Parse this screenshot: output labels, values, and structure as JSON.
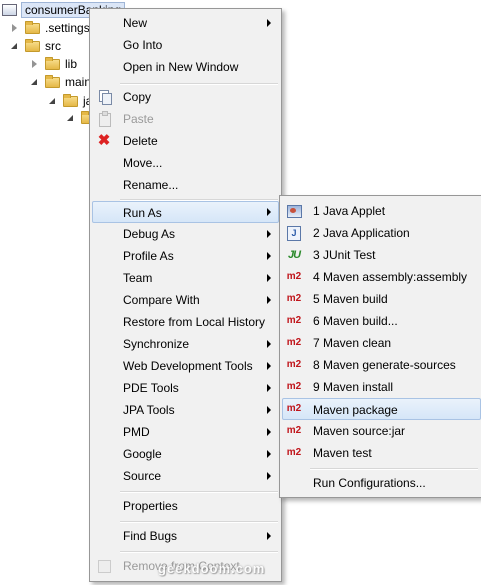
{
  "tree": {
    "project": "consumerBanking",
    "items": [
      {
        "label": ".settings"
      },
      {
        "label": "src"
      },
      {
        "label": "lib"
      },
      {
        "label": "main"
      },
      {
        "label": "ja"
      }
    ]
  },
  "context_menu": {
    "new": "New",
    "go_into": "Go Into",
    "open_in_new_window": "Open in New Window",
    "copy": "Copy",
    "paste": "Paste",
    "delete": "Delete",
    "move": "Move...",
    "rename": "Rename...",
    "run_as": "Run As",
    "debug_as": "Debug As",
    "profile_as": "Profile As",
    "team": "Team",
    "compare_with": "Compare With",
    "restore_from_local_history": "Restore from Local History",
    "synchronize": "Synchronize",
    "web_development_tools": "Web Development Tools",
    "pde_tools": "PDE Tools",
    "jpa_tools": "JPA Tools",
    "pmd": "PMD",
    "google": "Google",
    "source": "Source",
    "properties": "Properties",
    "find_bugs": "Find Bugs",
    "remove_from_context": "Remove from Context"
  },
  "run_as_menu": {
    "items": [
      {
        "label": "1 Java Applet",
        "icon": "java-applet-icon"
      },
      {
        "label": "2 Java Application",
        "icon": "java-application-icon"
      },
      {
        "label": "3 JUnit Test",
        "icon": "junit-icon"
      },
      {
        "label": "4 Maven assembly:assembly",
        "icon": "maven-m2-icon"
      },
      {
        "label": "5 Maven build",
        "icon": "maven-m2-icon"
      },
      {
        "label": "6 Maven build...",
        "icon": "maven-m2-icon"
      },
      {
        "label": "7 Maven clean",
        "icon": "maven-m2-icon"
      },
      {
        "label": "8 Maven generate-sources",
        "icon": "maven-m2-icon"
      },
      {
        "label": "9 Maven install",
        "icon": "maven-m2-icon"
      },
      {
        "label": "Maven package",
        "icon": "maven-m2-icon"
      },
      {
        "label": "Maven source:jar",
        "icon": "maven-m2-icon"
      },
      {
        "label": "Maven test",
        "icon": "maven-m2-icon"
      }
    ],
    "run_configurations": "Run Configurations..."
  },
  "icon_text": {
    "junit": "JU",
    "m2": "m2",
    "delete": "✖"
  },
  "watermark": "geekdoom.com",
  "colors": {
    "highlight": "#d6e6f8",
    "menu_bg": "#f1f1f1",
    "m2_red": "#c0151b"
  }
}
